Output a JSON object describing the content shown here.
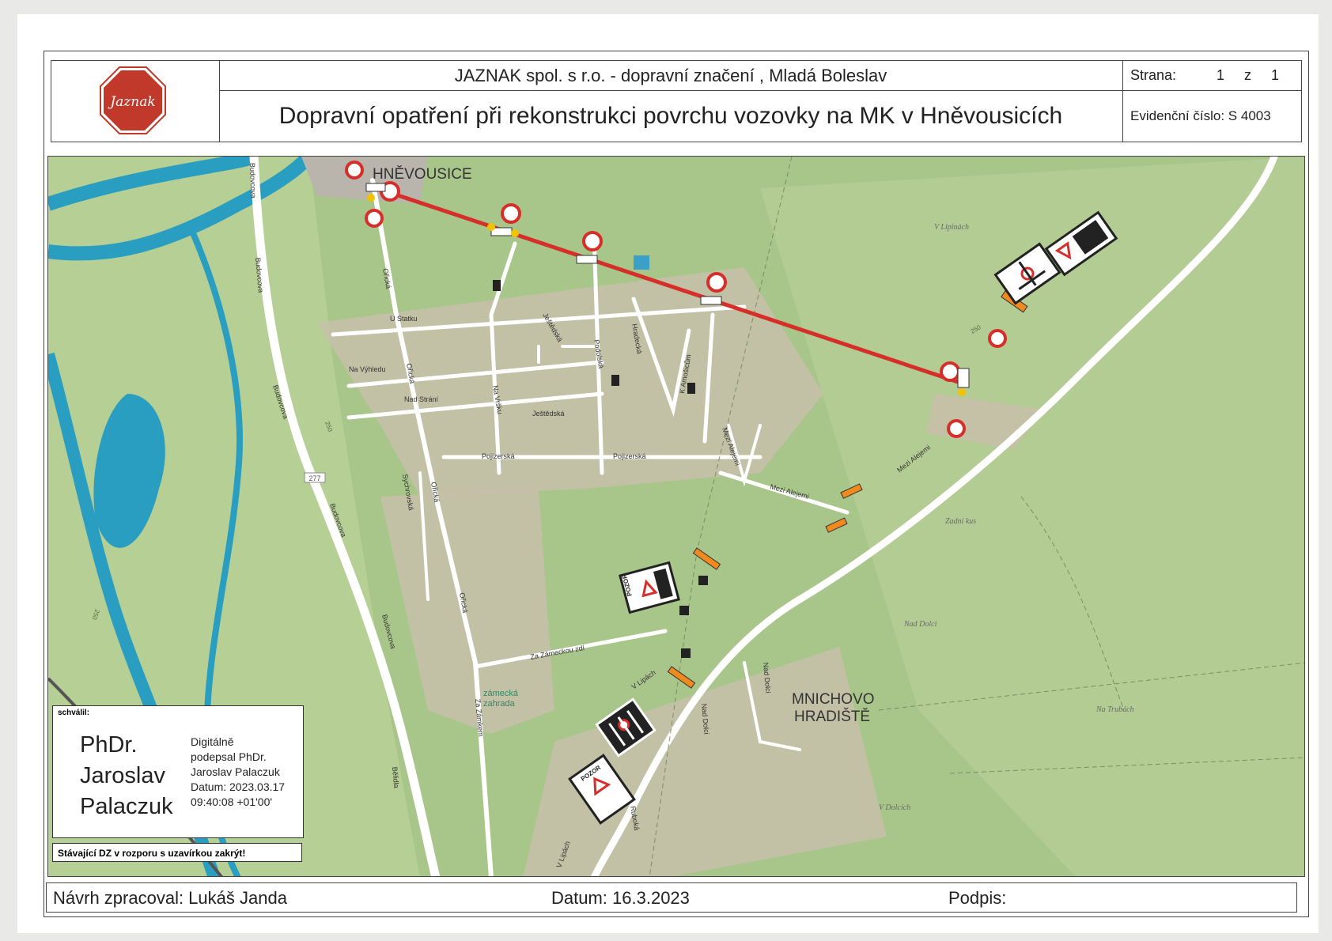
{
  "header": {
    "company": "JAZNAK spol. s r.o. - dopravní značení , Mladá Boleslav",
    "title": "Dopravní opatření při rekonstrukci povrchu vozovky na MK v Hněvousicích",
    "page_label": "Strana:",
    "page_value": "1 z 1",
    "record_label": "Evidenční číslo:",
    "record_value": "S 4003",
    "logo_text": "Jaznak"
  },
  "map": {
    "town_north": "HNĚVOUSICE",
    "town_south_line1": "MNICHOVO",
    "town_south_line2": "HRADIŠTĚ",
    "streets": [
      "U Statku",
      "Na Výhledu",
      "Nad Strání",
      "Ořická",
      "Ořická",
      "Ořická",
      "Ořická",
      "Ještědská",
      "Ještědská",
      "Na Vršku",
      "Podolská",
      "Hradecká",
      "K Amošicům",
      "Pojizerská",
      "Pojizerská",
      "Mezi Alejemi",
      "Mezi Alejemi",
      "Mezi Alejemi",
      "Budovcova",
      "Budovcova",
      "Budovcova",
      "Budovcova",
      "Budovcova",
      "Sychrovská",
      "Za Zámeckou zdí",
      "V Lipách",
      "V Lipách",
      "Nad Dolci",
      "Nad Dolci",
      "Za Zámkem",
      "Bělidla",
      "Ruboká"
    ],
    "localities": [
      "V Lipinách",
      "Zadní kus",
      "Nad Dolci",
      "Na Trubách",
      "V Dolcích"
    ],
    "park": [
      "zámecká",
      "zahrada"
    ],
    "road_number": "277",
    "contours": [
      "250",
      "250",
      "250"
    ],
    "sign_pozor": "POZOR",
    "colors": {
      "closure_line": "#d62f2a",
      "water": "#2a9ec0",
      "land": "#a9c68a",
      "built": "#c8beab",
      "road": "#ffffff"
    }
  },
  "approval": {
    "label": "schválil:",
    "name_line1": "PhDr.",
    "name_line2": "Jaroslav",
    "name_line3": "Palaczuk",
    "sig1": "Digitálně",
    "sig2": "podepsal PhDr.",
    "sig3": "Jaroslav Palaczuk",
    "sig4": "Datum: 2023.03.17",
    "sig5": "09:40:08 +01'00'"
  },
  "note": "Stávající DZ v rozporu s uzavírkou zakrýt!",
  "footer": {
    "author": "Návrh zpracoval: Lukáš Janda",
    "date": "Datum: 16.3.2023",
    "signature": "Podpis:"
  }
}
